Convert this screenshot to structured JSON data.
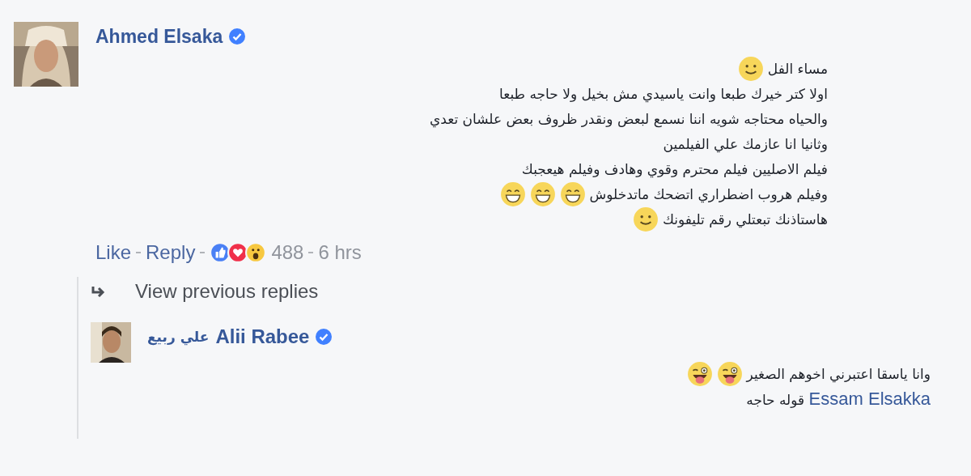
{
  "comment": {
    "author": "Ahmed Elsaka",
    "verified": true,
    "lines": [
      {
        "text": "مساء الفل",
        "emojis": [
          {
            "kind": "smile"
          }
        ]
      },
      {
        "text": "اولا كتر خيرك طبعا وانت ياسيدي مش بخيل ولا حاجه طبعا"
      },
      {
        "text": "والحياه محتاجه شويه اننا نسمع لبعض ونقدر ظروف بعض علشان تعدي"
      },
      {
        "text": "وثانيا انا عازمك علي الفيلمين"
      },
      {
        "text": "فيلم الاصليين فيلم محترم وقوي وهادف وفيلم هيعجبك"
      },
      {
        "text": "وفيلم هروب اضطراري اتضحك ماتدخلوش",
        "emojis": [
          {
            "kind": "grin"
          },
          {
            "kind": "grin"
          },
          {
            "kind": "grin"
          }
        ]
      },
      {
        "text": "هاستاذنك تبعتلي رقم تليفونك",
        "emojis": [
          {
            "kind": "smile"
          }
        ]
      }
    ],
    "like_link": "Like",
    "reply_link": "Reply",
    "reactions": [
      {
        "kind": "like"
      },
      {
        "kind": "love"
      },
      {
        "kind": "wow"
      }
    ],
    "reaction_count": "488",
    "time": "6 hrs"
  },
  "view_previous": "View previous replies",
  "reply": {
    "name_secondary": "علي ربيع",
    "author": "Alii Rabee",
    "verified": true,
    "lines": [
      {
        "segments": [
          {
            "kind": "text",
            "text": "وانا ياسقا اعتبرني اخوهم الصغير"
          }
        ],
        "emojis": [
          {
            "kind": "tongue"
          },
          {
            "kind": "tongue"
          }
        ]
      },
      {
        "segments": [
          {
            "kind": "mention",
            "text": "Essam Elsakka"
          },
          {
            "kind": "text",
            "text": "قوله حاجه"
          }
        ]
      }
    ]
  }
}
